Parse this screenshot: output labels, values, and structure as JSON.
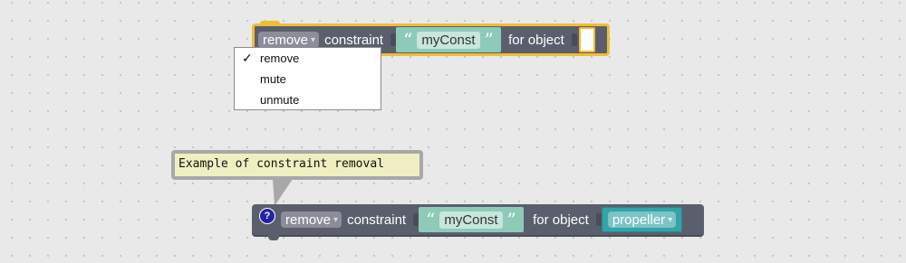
{
  "block_top": {
    "action_dropdown": "remove",
    "constraint_label": "constraint",
    "constraint_name": "myConst",
    "object_label": "for object"
  },
  "dropdown_menu": {
    "items": [
      {
        "label": "remove",
        "checked": true
      },
      {
        "label": "mute",
        "checked": false
      },
      {
        "label": "unmute",
        "checked": false
      }
    ],
    "check_mark": "✓"
  },
  "comment_bubble": {
    "text": "Example of constraint removal"
  },
  "block_bottom": {
    "help_icon": "?",
    "action_dropdown": "remove",
    "constraint_label": "constraint",
    "constraint_name": "myConst",
    "object_label": "for object",
    "object_value": "propeller"
  },
  "glyphs": {
    "open_quote": "“",
    "close_quote": "”",
    "dropdown_arrow": "▾"
  },
  "colors": {
    "workspace": "#e9e9e9",
    "block": "#5b5f6d",
    "selected_outline": "#f1bd36",
    "string_block": "#8fcab9",
    "object_block": "#33a4a8",
    "comment": "#f0efc1"
  }
}
